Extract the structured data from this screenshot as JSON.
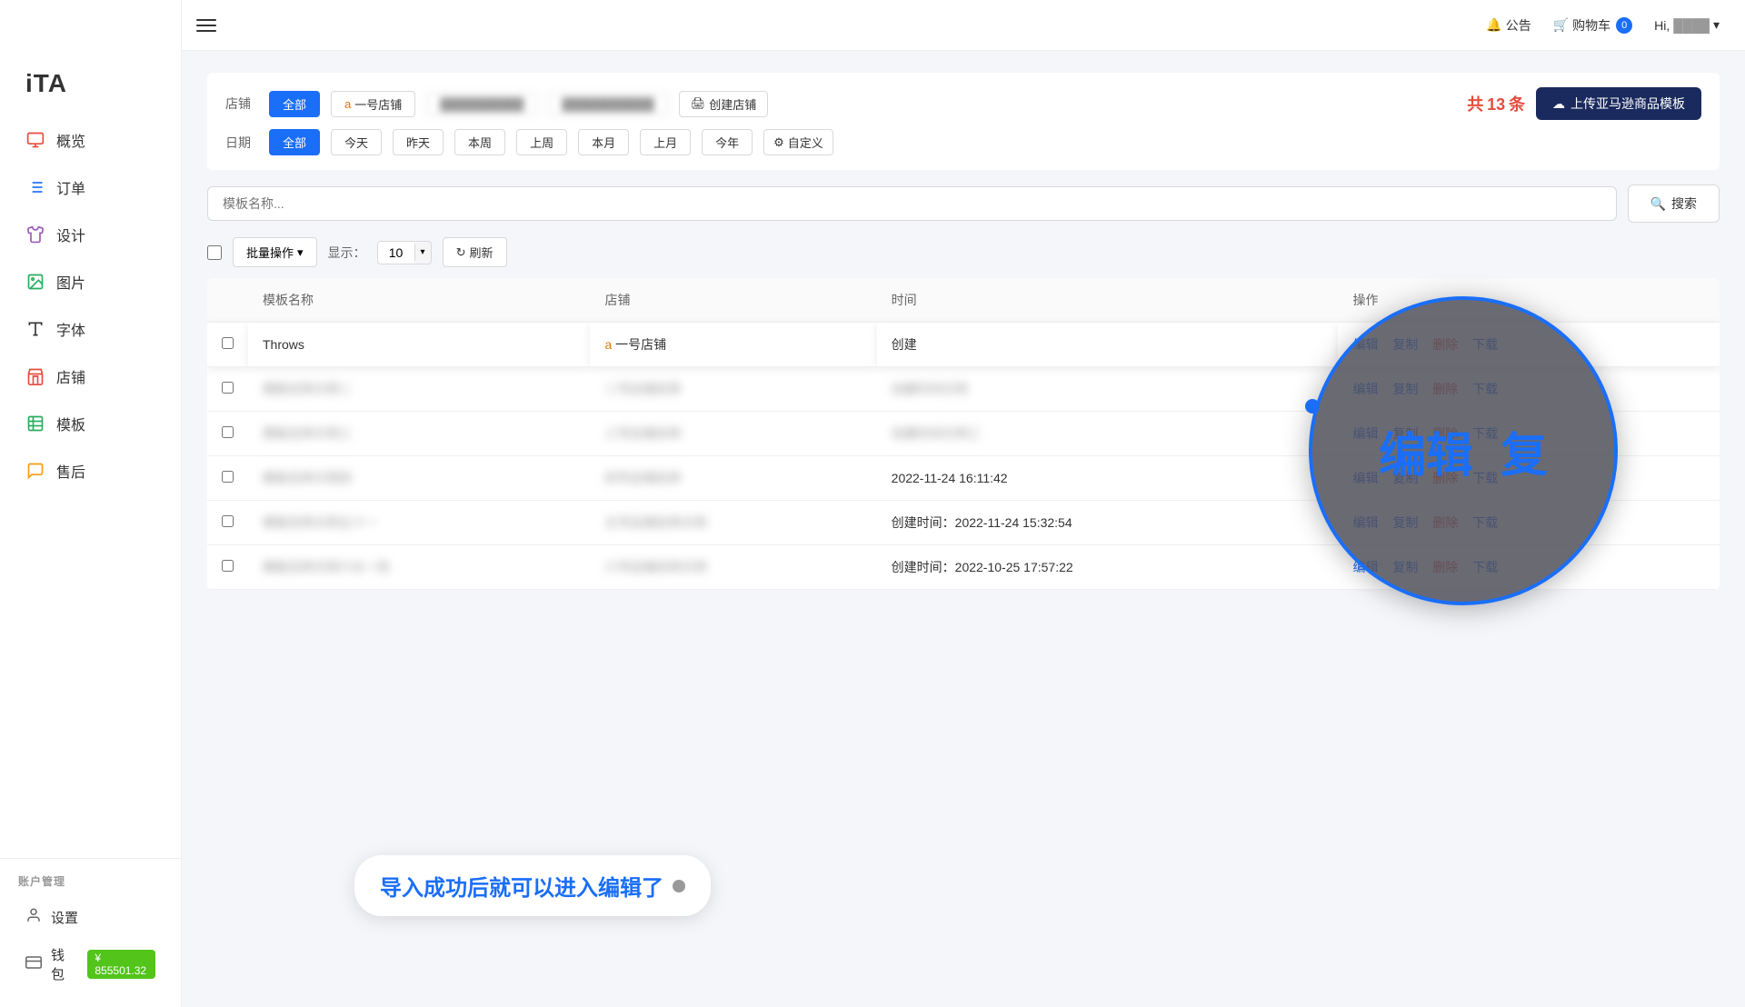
{
  "sidebar": {
    "logo": "iTA",
    "items": [
      {
        "id": "overview",
        "label": "概览",
        "icon": "monitor"
      },
      {
        "id": "orders",
        "label": "订单",
        "icon": "list"
      },
      {
        "id": "design",
        "label": "设计",
        "icon": "shirt"
      },
      {
        "id": "images",
        "label": "图片",
        "icon": "image"
      },
      {
        "id": "fonts",
        "label": "字体",
        "icon": "font"
      },
      {
        "id": "store",
        "label": "店铺",
        "icon": "store"
      },
      {
        "id": "templates",
        "label": "模板",
        "icon": "table"
      },
      {
        "id": "aftersale",
        "label": "售后",
        "icon": "chat"
      }
    ],
    "account_label": "账户管理",
    "bottom_items": [
      {
        "id": "settings",
        "label": "设置",
        "icon": "user"
      },
      {
        "id": "wallet",
        "label": "钱包",
        "icon": "wallet",
        "badge": "¥ 855501.32"
      }
    ]
  },
  "topbar": {
    "notice": "公告",
    "cart": "购物车",
    "cart_count": "0",
    "hi": "Hi,",
    "user": "用户"
  },
  "filter": {
    "store_label": "店铺",
    "all_btn": "全部",
    "store1": "一号店铺",
    "create_store": "创建店铺",
    "total_prefix": "共",
    "total_count": "13",
    "total_suffix": "条",
    "date_label": "日期",
    "date_options": [
      "全部",
      "今天",
      "昨天",
      "本周",
      "上周",
      "本月",
      "上月",
      "今年"
    ],
    "custom_btn": "自定义",
    "upload_btn": "上传亚马逊商品模板"
  },
  "search": {
    "placeholder": "模板名称...",
    "search_btn": "搜索"
  },
  "toolbar": {
    "batch_btn": "批量操作",
    "display_label": "显示：",
    "display_value": "10",
    "refresh_btn": "刷新"
  },
  "table": {
    "headers": [
      "模板名称",
      "店铺",
      "时间",
      "操作"
    ],
    "rows": [
      {
        "id": 1,
        "name": "Throws",
        "store": "一号店铺",
        "time": "创建",
        "actions": [
          "编辑",
          "复制",
          "删除",
          "下载"
        ],
        "highlighted": true
      },
      {
        "id": 2,
        "name": "blurred_row2",
        "store": "blurred_store2",
        "time": "blurred_time2",
        "actions": [
          "编辑",
          "复制",
          "删除",
          "下载"
        ],
        "blurred": true
      },
      {
        "id": 3,
        "name": "blurred_row3",
        "store": "blurred_store3",
        "time": "blurred_time3",
        "actions": [
          "编辑",
          "复制",
          "删除",
          "下载"
        ],
        "blurred": true
      },
      {
        "id": 4,
        "name": "blurred_row4",
        "store": "blurred_store4",
        "time": "2022-11-24 16:11:42",
        "actions": [
          "编辑",
          "复制",
          "删除",
          "下载"
        ],
        "blurred": false
      },
      {
        "id": 5,
        "name": "blurred_row5",
        "store": "blurred_store5",
        "time": "创建时间：2022-11-24 15:32:54",
        "actions": [
          "编辑",
          "复制",
          "删除",
          "下载"
        ],
        "blurred": true
      },
      {
        "id": 6,
        "name": "blurred_row6",
        "store": "blurred_store6",
        "time": "创建时间：2022-10-25 17:57:22",
        "actions": [
          "编辑",
          "复制",
          "删除",
          "下载"
        ],
        "blurred": true
      }
    ]
  },
  "magnifier": {
    "text1": "编辑",
    "text2": "复"
  },
  "tooltip": {
    "text": "导入成功后就可以进入编辑了"
  },
  "connector_dot": ""
}
